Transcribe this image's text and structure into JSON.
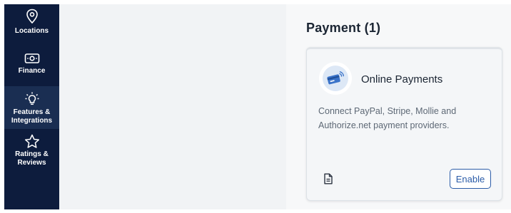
{
  "sidebar": {
    "items": [
      {
        "label": "Locations",
        "icon": "location-pin-icon",
        "active": false
      },
      {
        "label": "Finance",
        "icon": "money-icon",
        "active": false
      },
      {
        "label": "Features & Integrations",
        "icon": "lightbulb-icon",
        "active": true
      },
      {
        "label": "Ratings & Reviews",
        "icon": "star-icon",
        "active": false
      }
    ]
  },
  "section": {
    "title": "Payment (1)"
  },
  "card": {
    "icon": "credit-card-contactless-icon",
    "title": "Online Payments",
    "description": "Connect PayPal, Stripe, Mollie and Authorize.net payment providers.",
    "doc_icon": "document-icon",
    "enable_label": "Enable"
  },
  "colors": {
    "sidebar_bg": "#0d1c3d",
    "sidebar_active_bg": "#1a2e52",
    "accent": "#2b5ca8"
  }
}
